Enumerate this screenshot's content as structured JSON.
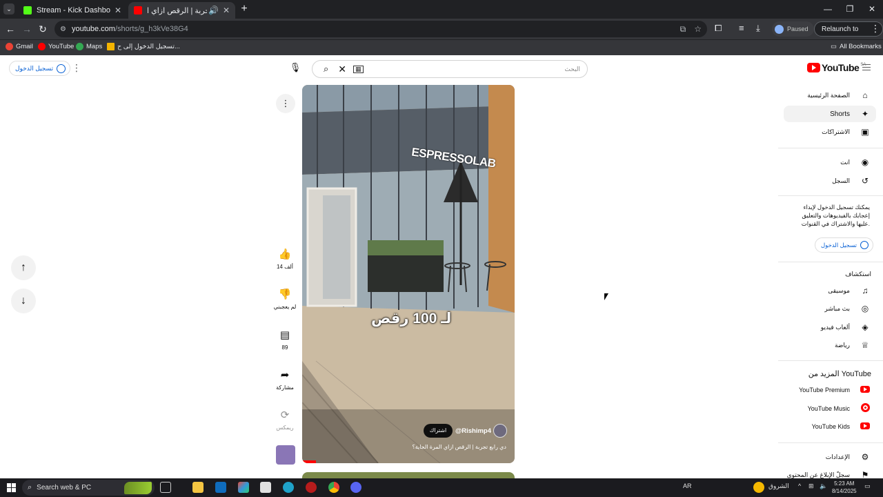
{
  "browser": {
    "tabs": [
      {
        "title": "Stream - Kick Dashboard",
        "favicon_color": "#53fc18"
      },
      {
        "title": "دي رابع تجربة | الرقص ازاي ا...",
        "favicon_color": "#ff0000"
      }
    ],
    "url_host": "youtube.com",
    "url_path": "/shorts/g_h3kVe38G4",
    "profile_status": "Paused",
    "relaunch_label": "Relaunch to update",
    "bookmarks": [
      {
        "label": "Gmail",
        "color": "#ea4335"
      },
      {
        "label": "YouTube",
        "color": "#ff0000"
      },
      {
        "label": "Maps",
        "color": "#34a853"
      },
      {
        "label": "تسجيل الدخول إلى ح...",
        "color": "#f4b400"
      }
    ],
    "all_bookmarks_label": "All Bookmarks"
  },
  "header": {
    "signin_label": "تسجيل الدخول",
    "search_placeholder": "البحث",
    "logo_text": "YouTube",
    "region_code": "SA"
  },
  "sidebar": {
    "main_items": [
      {
        "label": "الصفحة الرئيسية",
        "icon": "home-icon",
        "glyph": "⌂"
      },
      {
        "label": "Shorts",
        "icon": "shorts-icon",
        "glyph": "✦",
        "active": true
      },
      {
        "label": "الاشتراكات",
        "icon": "subscriptions-icon",
        "glyph": "▣"
      }
    ],
    "you_items": [
      {
        "label": "انت",
        "icon": "account-icon",
        "glyph": "◉"
      },
      {
        "label": "السجل",
        "icon": "history-icon",
        "glyph": "↺"
      }
    ],
    "signin_prompt": "يمكنك تسجيل الدخول لإبداء إعجابك بالفيديوهات والتعليق عليها والاشتراك في القنوات.",
    "signin_button": "تسجيل الدخول",
    "explore_heading": "استكشاف",
    "explore_items": [
      {
        "label": "موسيقى",
        "icon": "music-icon",
        "glyph": "♫"
      },
      {
        "label": "بث مباشر",
        "icon": "live-icon",
        "glyph": "◎"
      },
      {
        "label": "ألعاب فيديو",
        "icon": "gaming-icon",
        "glyph": "◈"
      },
      {
        "label": "رياضة",
        "icon": "trophy-icon",
        "glyph": "♕"
      }
    ],
    "more_heading": "المزيد من YouTube",
    "more_items": [
      {
        "label": "YouTube Premium",
        "icon": "youtube-premium-icon"
      },
      {
        "label": "YouTube Music",
        "icon": "youtube-music-icon"
      },
      {
        "label": "YouTube Kids",
        "icon": "youtube-kids-icon"
      }
    ],
    "bottom_items": [
      {
        "label": "الإعدادات",
        "icon": "settings-icon",
        "glyph": "⚙"
      },
      {
        "label": "سجلّ الإبلاغ عن المحتوى",
        "icon": "flag-icon",
        "glyph": "⚑"
      }
    ]
  },
  "short": {
    "overlay_text": "لـ 100 رقص",
    "channel": "@Rishimp4",
    "subscribe_label": "اشتراك",
    "caption": "دي رابع تجربة | الرقص ازاي المرة الجاية؟",
    "storefront_sign": "ESPRESSOLAB"
  },
  "actions": {
    "like_count": "14 ألف",
    "dislike_label": "لم يعجبني",
    "comment_count": "89",
    "share_label": "مشاركة",
    "remix_label": "ريمكس"
  },
  "taskbar": {
    "search_placeholder": "Search web & PC",
    "weather_label": "الشروق",
    "lang": "AR",
    "time": "5:23 AM",
    "date": "8/14/2025"
  }
}
